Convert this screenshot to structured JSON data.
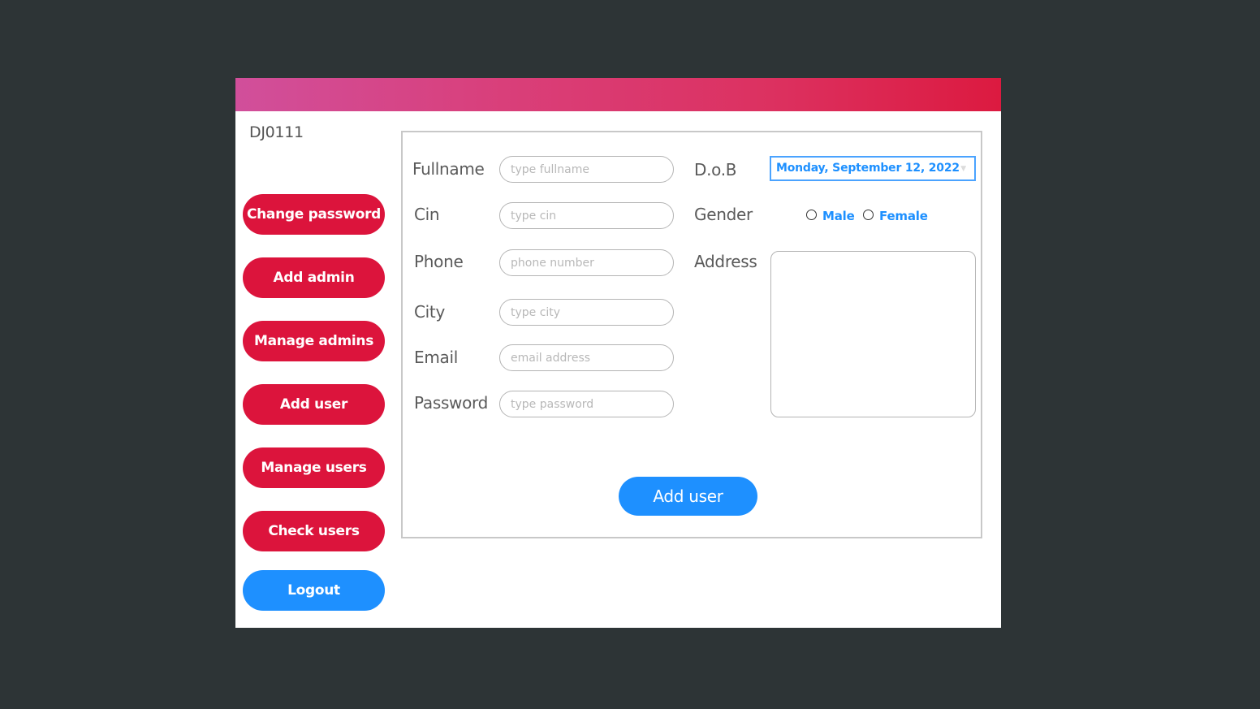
{
  "header": {
    "user_id": "DJ0111"
  },
  "sidebar": {
    "items": [
      {
        "label": "Change password",
        "color": "#dc143c"
      },
      {
        "label": "Add admin",
        "color": "#dc143c"
      },
      {
        "label": "Manage admins",
        "color": "#dc143c"
      },
      {
        "label": "Add user",
        "color": "#dc143c"
      },
      {
        "label": "Manage users",
        "color": "#dc143c"
      },
      {
        "label": "Check users",
        "color": "#dc143c"
      },
      {
        "label": "Logout",
        "color": "#1e90ff"
      }
    ]
  },
  "form": {
    "fullname": {
      "label": "Fullname",
      "placeholder": "type fullname",
      "value": ""
    },
    "cin": {
      "label": "Cin",
      "placeholder": "type cin",
      "value": ""
    },
    "phone": {
      "label": "Phone",
      "placeholder": "phone number",
      "value": ""
    },
    "city": {
      "label": "City",
      "placeholder": "type city",
      "value": ""
    },
    "email": {
      "label": "Email",
      "placeholder": "email address",
      "value": ""
    },
    "password": {
      "label": "Password",
      "placeholder": "type password",
      "value": ""
    },
    "dob": {
      "label": "D.o.B",
      "value": "Monday, September 12, 2022",
      "dropdown_icon": "chevron-down-icon"
    },
    "gender": {
      "label": "Gender",
      "options": [
        "Male",
        "Female"
      ],
      "selected": null
    },
    "address": {
      "label": "Address",
      "value": ""
    },
    "submit_label": "Add user"
  },
  "colors": {
    "accent_red": "#dc143c",
    "accent_blue": "#1e90ff",
    "header_gradient_start": "#d14f9b",
    "header_gradient_end": "#dc1a40",
    "backdrop": "#2d3436"
  }
}
